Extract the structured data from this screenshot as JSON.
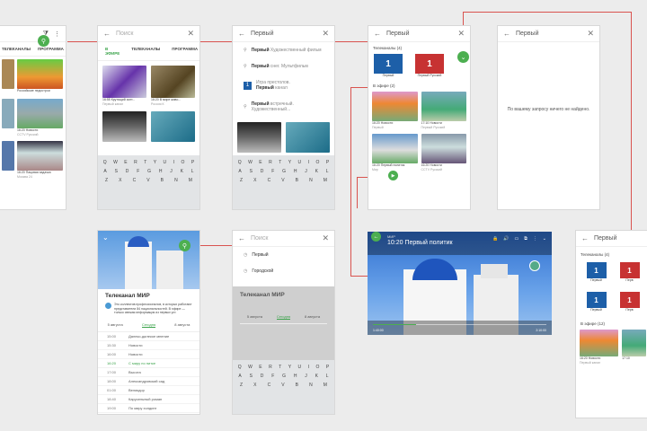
{
  "screen1": {
    "tabs": [
      "ТЕЛЕКАНАЛЫ",
      "ПРОГРАММА"
    ],
    "items": [
      {
        "title": "Российские недострои",
        "sub": "Карусель"
      },
      {
        "title": "16:20 Новости",
        "sub": "CCTV Русский"
      },
      {
        "title": "16:20 Пацовая задачка",
        "sub": "Москва 24"
      }
    ]
  },
  "screen2": {
    "search_placeholder": "Поиск",
    "tabs": [
      "В ЭФИРЕ",
      "ТЕЛЕКАНАЛЫ",
      "ПРОГРАММА"
    ],
    "items": [
      {
        "title": "16:55 Крутящий зонт...",
        "sub": "Первый канал"
      },
      {
        "title": "16:20 В мире живо...",
        "sub": "Россия К"
      }
    ]
  },
  "screen3": {
    "search_value": "Первый",
    "suggestions": [
      {
        "bold": "Первый",
        "rest": " Художественный фильм"
      },
      {
        "bold": "Первый",
        "rest": " снег. Мультфильм"
      },
      {
        "bold": "Первый",
        "rest": " канал",
        "pre": "Игра престолов. "
      },
      {
        "bold": "Первый",
        "rest": " встречный. Художественный..."
      }
    ]
  },
  "screen4": {
    "search_value": "Первый",
    "channels_header": "Телеканалы (4)",
    "channels": [
      {
        "name": "Первый",
        "logo": "1"
      },
      {
        "name": "Первый Русский",
        "logo": "1"
      }
    ],
    "onair_header": "В эфире (2)",
    "items": [
      {
        "time": "16:20 Новости",
        "sub": "Первый"
      },
      {
        "time": "17:10 Новости",
        "sub": "Первый Русский"
      },
      {
        "time": "16:20 Первый политик",
        "sub": "Мир"
      },
      {
        "time": "16:20 Новости",
        "sub": "CCTV Русский"
      }
    ]
  },
  "screen5": {
    "search_value": "Первый",
    "empty": "По вашему запросу ничего не найдено."
  },
  "screen6": {
    "title": "Телеканал МИР",
    "desc": "Это коллектив профессионалов, в которых работают представители 84 национальностей. В эфире — только свежая информация из первых уст.",
    "days": [
      "5 августа",
      "Сегодня",
      "8 августа"
    ],
    "schedule": [
      {
        "t": "15:00",
        "n": "Далеко-далекое мнение"
      },
      {
        "t": "15:30",
        "n": "Новости"
      },
      {
        "t": "16:00",
        "n": "Новости"
      },
      {
        "t": "16:20",
        "n": "С миру по нитке"
      },
      {
        "t": "17:00",
        "n": "Высота"
      },
      {
        "t": "18:00",
        "n": "Александровский сад"
      },
      {
        "t": "01:00",
        "n": "Великдор"
      },
      {
        "t": "18:40",
        "n": "Карусельный роман"
      },
      {
        "t": "19:00",
        "n": "По миру холдинг"
      }
    ]
  },
  "screen7": {
    "search_placeholder": "Поиск",
    "suggestions": [
      "Первый",
      "Городской"
    ],
    "title": "Телеканал МИР",
    "days": [
      "5 августа",
      "Сегодня",
      "8 августа"
    ]
  },
  "player": {
    "channel": "МИР",
    "title": "10:20 Первый политик",
    "time_start": "1:40:00",
    "time_end": "2:10:00",
    "progress": 0.25
  },
  "screen8": {
    "search_value": "Первый",
    "channels_header": "Телеканалы (4)",
    "channels": [
      "Первый",
      "Перв",
      "Первый",
      "Перв"
    ],
    "onair_header": "В эфире (12)",
    "items": [
      {
        "time": "16:20 Новости",
        "sub": "Первый канал"
      },
      {
        "time": "17:10",
        "sub": ""
      }
    ]
  },
  "keyboard": {
    "row1": [
      "Q",
      "W",
      "E",
      "R",
      "T",
      "Y",
      "U",
      "I",
      "O",
      "P"
    ],
    "row2": [
      "A",
      "S",
      "D",
      "F",
      "G",
      "H",
      "J",
      "K",
      "L"
    ],
    "row3": [
      "Z",
      "X",
      "C",
      "V",
      "B",
      "N",
      "M"
    ]
  },
  "colors": {
    "accent": "#3aa34a",
    "arrow": "#d9534f",
    "logo": "#1d5fa8"
  }
}
